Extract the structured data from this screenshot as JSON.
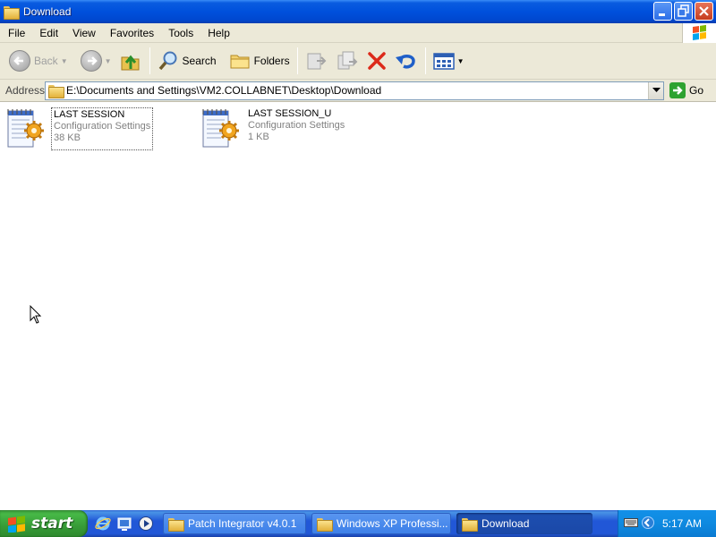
{
  "window": {
    "title": "Download"
  },
  "menu": {
    "items": [
      "File",
      "Edit",
      "View",
      "Favorites",
      "Tools",
      "Help"
    ]
  },
  "toolbar": {
    "back_label": "Back",
    "search_label": "Search",
    "folders_label": "Folders"
  },
  "address": {
    "label": "Address",
    "path": "E:\\Documents and Settings\\VM2.COLLABNET\\Desktop\\Download",
    "go_label": "Go"
  },
  "files": [
    {
      "name": "LAST SESSION",
      "type": "Configuration Settings",
      "size": "38 KB"
    },
    {
      "name": "LAST SESSION_U",
      "type": "Configuration Settings",
      "size": "1 KB"
    }
  ],
  "taskbar": {
    "start_label": "start",
    "tasks": [
      {
        "label": "Patch Integrator v4.0.1"
      },
      {
        "label": "Windows XP Professi..."
      },
      {
        "label": "Download"
      }
    ],
    "clock": "5:17 AM"
  },
  "colors": {
    "titlebar": "#0050dc",
    "chrome": "#ece9d8",
    "taskbar": "#2157d7",
    "start": "#379b37",
    "tray": "#0f8ae0"
  }
}
